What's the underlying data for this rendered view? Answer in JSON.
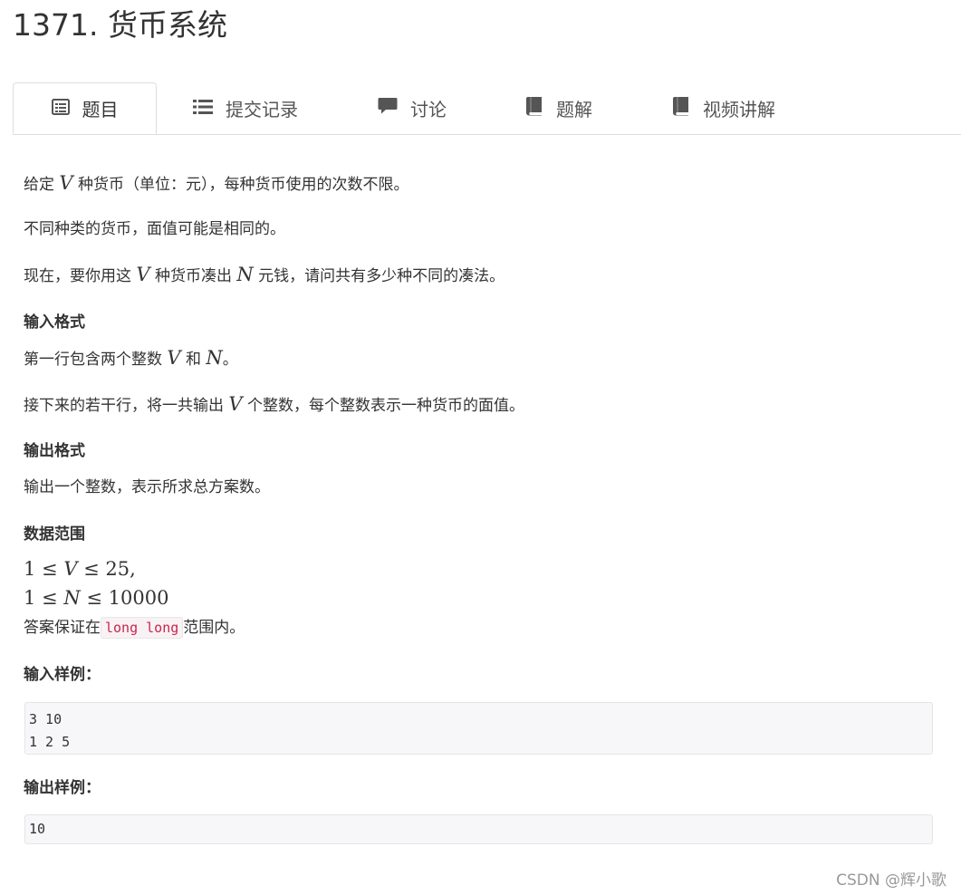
{
  "problem": {
    "title": "1371. 货币系统"
  },
  "tabs": [
    {
      "label": "题目",
      "icon": "list-alt-icon",
      "active": true
    },
    {
      "label": "提交记录",
      "icon": "list-icon",
      "active": false
    },
    {
      "label": "讨论",
      "icon": "comment-icon",
      "active": false
    },
    {
      "label": "题解",
      "icon": "book-icon",
      "active": false
    },
    {
      "label": "视频讲解",
      "icon": "book-icon",
      "active": false
    }
  ],
  "body": {
    "p1": {
      "a": "给定 ",
      "m1": "V",
      "b": " 种货币（单位：元），每种货币使用的次数不限。"
    },
    "p2": "不同种类的货币，面值可能是相同的。",
    "p3": {
      "a": "现在，要你用这 ",
      "m1": "V",
      "b": " 种货币凑出 ",
      "m2": "N",
      "c": " 元钱，请问共有多少种不同的凑法。"
    },
    "input_format_header": "输入格式",
    "p4": {
      "a": "第一行包含两个整数 ",
      "m1": "V",
      "b": " 和 ",
      "m2": "N",
      "c": "。"
    },
    "p5": {
      "a": "接下来的若干行，将一共输出 ",
      "m1": "V",
      "b": " 个整数，每个整数表示一种货币的面值。"
    },
    "output_format_header": "输出格式",
    "p6": "输出一个整数，表示所求总方案数。",
    "range_header": "数据范围",
    "range1": {
      "a": "1 ≤ ",
      "m1": "V",
      "b": " ≤ 25",
      "c": ","
    },
    "range2": {
      "a": "1 ≤ ",
      "m1": "N",
      "b": " ≤ 10000"
    },
    "p7": {
      "a": "答案保证在",
      "code": "long long",
      "b": "范围内。"
    },
    "sample_input_header": "输入样例：",
    "sample_input_lines": [
      "3 10",
      "1 2 5"
    ],
    "sample_output_header": "输出样例：",
    "sample_output_lines": [
      "10"
    ]
  },
  "watermark": "CSDN @辉小歌"
}
